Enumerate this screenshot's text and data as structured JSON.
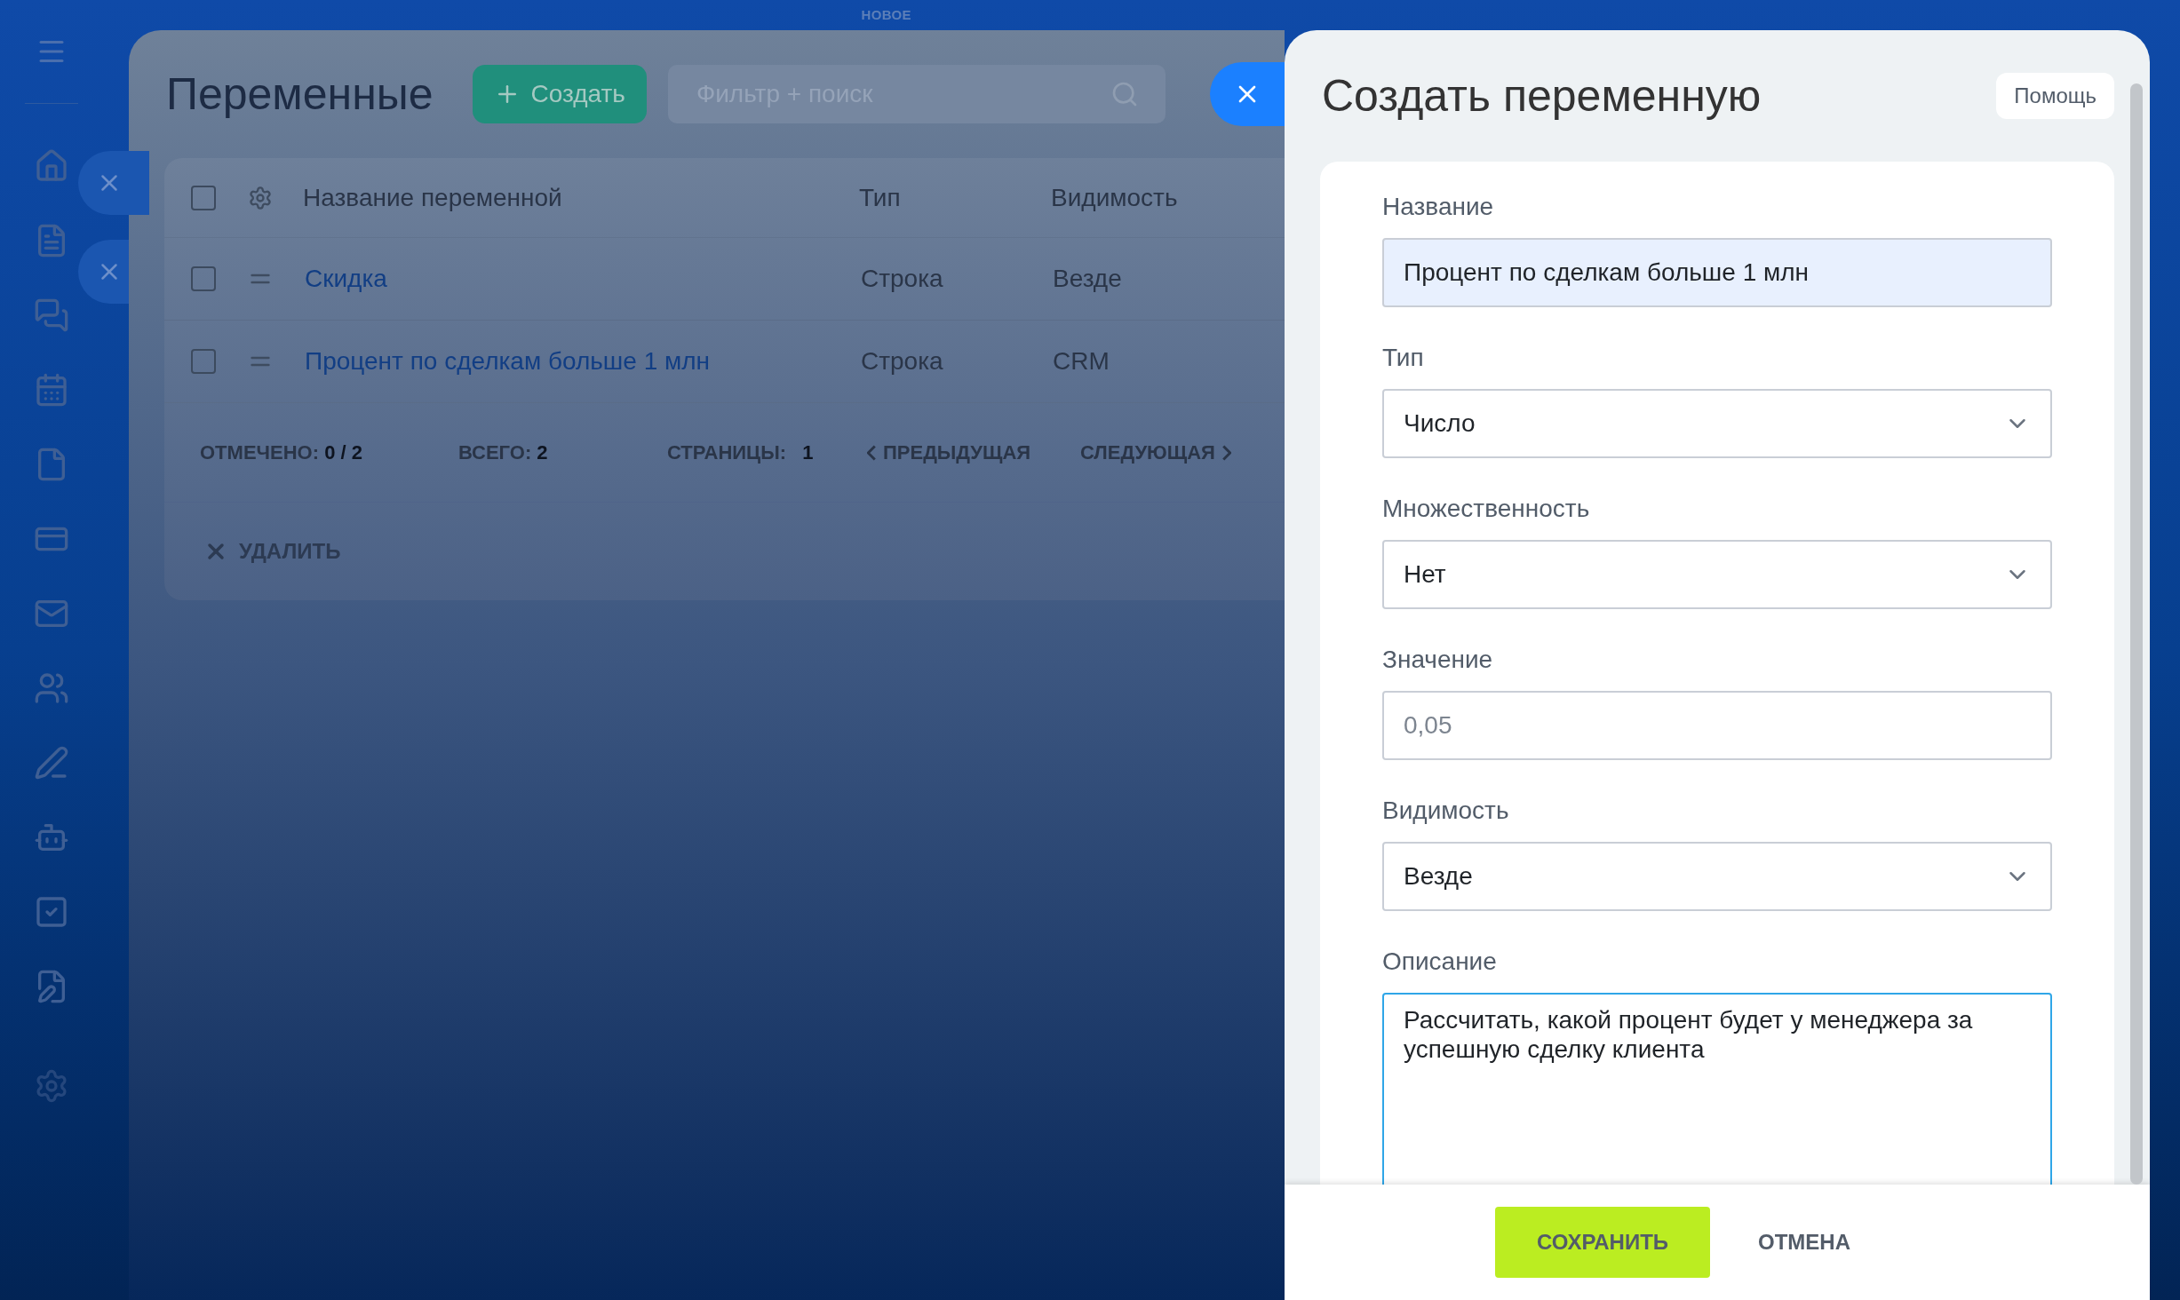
{
  "top_label": "НОВОЕ",
  "list_page": {
    "title": "Переменные",
    "create_button": "Создать",
    "search": {
      "placeholder": "Фильтр + поиск"
    },
    "table": {
      "select_all_checked": false,
      "columns": [
        "Название переменной",
        "Тип",
        "Видимость"
      ],
      "rows": [
        {
          "name": "Скидка",
          "type": "Строка",
          "visibility": "Везде",
          "checked": false
        },
        {
          "name": "Процент по сделкам больше 1 млн",
          "type": "Строка",
          "visibility": "CRM",
          "checked": false
        }
      ]
    },
    "footer": {
      "marked_label": "ОТМЕЧЕНО:",
      "marked_value": "0 / 2",
      "total_label": "ВСЕГО:",
      "total_value": "2",
      "pages_label": "СТРАНИЦЫ:",
      "pages_value": "1",
      "prev": "ПРЕДЫДУЩАЯ",
      "next": "СЛЕДУЮЩАЯ"
    },
    "delete_action": "УДАЛИТЬ"
  },
  "form": {
    "title": "Создать переменную",
    "help_button": "Помощь",
    "fields": [
      {
        "kind": "text",
        "label": "Название",
        "value": "Процент по сделкам больше 1 млн",
        "autofilled": true,
        "focused": false
      },
      {
        "kind": "select",
        "label": "Тип",
        "value": "Число",
        "autofilled": false,
        "focused": false
      },
      {
        "kind": "select",
        "label": "Множественность",
        "value": "Нет",
        "autofilled": false,
        "focused": false
      },
      {
        "kind": "text",
        "label": "Значение",
        "placeholder": "0,05",
        "autofilled": false,
        "focused": false
      },
      {
        "kind": "select",
        "label": "Видимость",
        "value": "Везде",
        "autofilled": false,
        "focused": false
      },
      {
        "kind": "textarea",
        "label": "Описание",
        "value": "Рассчитать, какой процент будет у менеджера за успешную сделку клиента",
        "autofilled": false,
        "focused": true
      }
    ],
    "save_button": "СОХРАНИТЬ",
    "cancel_button": "ОТМЕНА"
  }
}
